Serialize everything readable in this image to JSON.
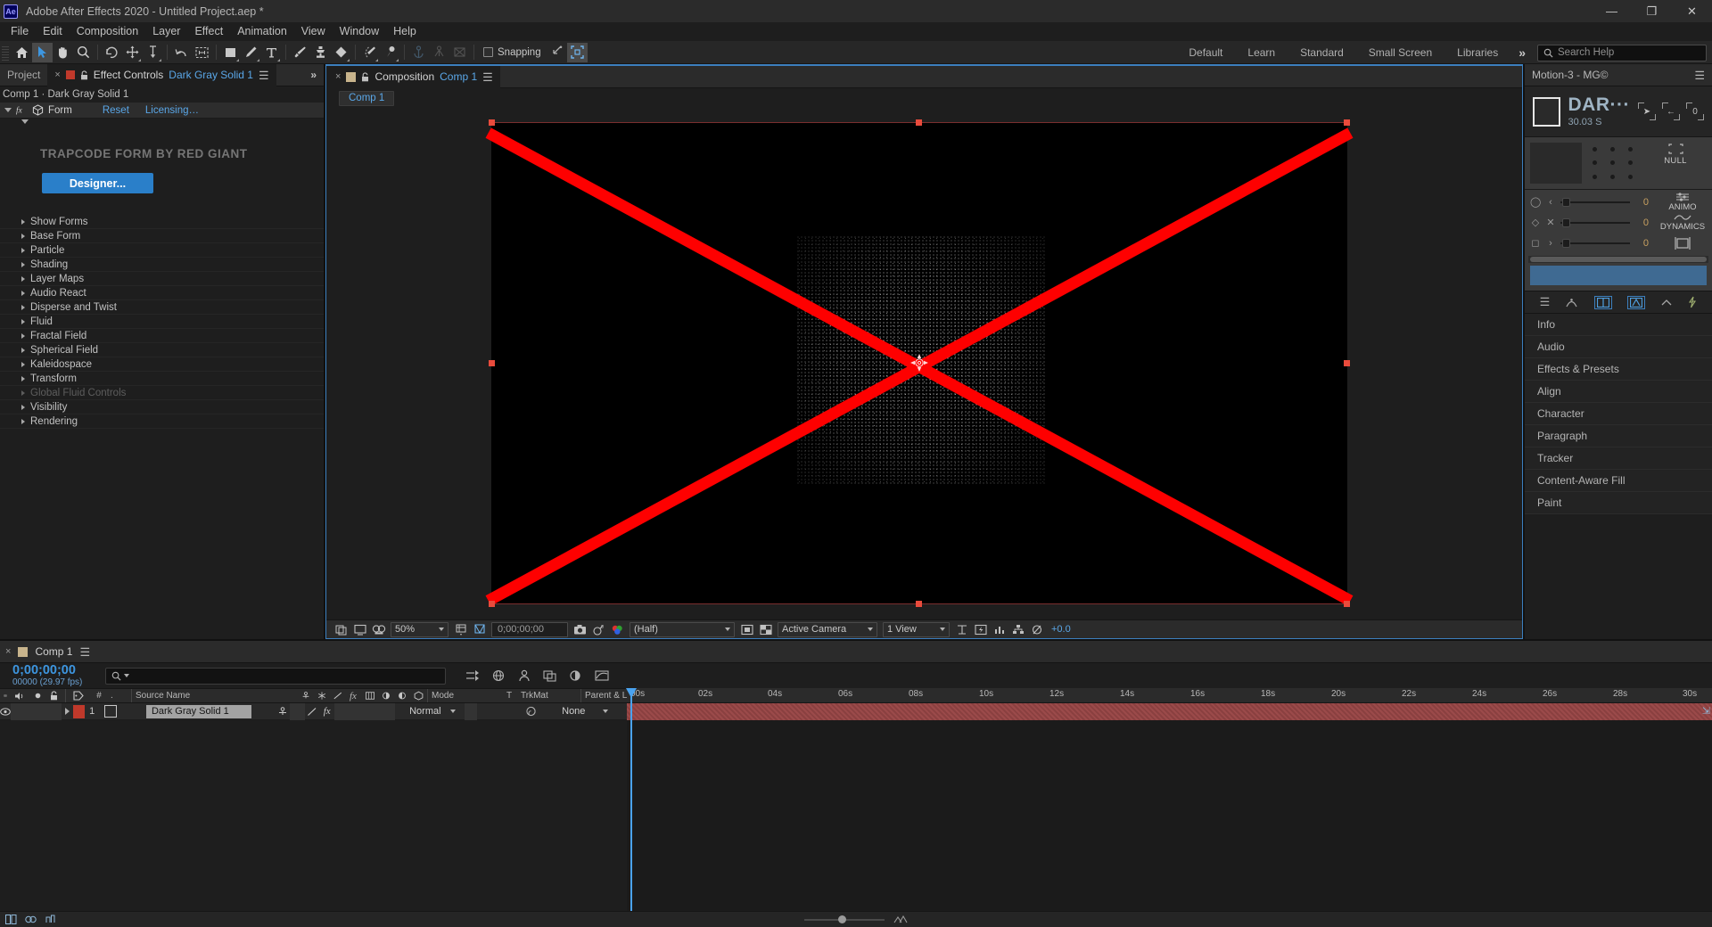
{
  "titlebar": {
    "logo": "Ae",
    "title": "Adobe After Effects 2020 - Untitled Project.aep *",
    "minimize": "—",
    "maximize": "❐",
    "close": "✕"
  },
  "menubar": {
    "items": [
      "File",
      "Edit",
      "Composition",
      "Layer",
      "Effect",
      "Animation",
      "View",
      "Window",
      "Help"
    ]
  },
  "toolbar": {
    "snapping_label": "Snapping",
    "workspaces": [
      "Default",
      "Learn",
      "Standard",
      "Small Screen",
      "Libraries"
    ],
    "more": "»",
    "search_placeholder": "Search Help",
    "tools": [
      "home-icon",
      "selection-tool",
      "hand-tool",
      "zoom-tool",
      "rotation-tool",
      "unified-camera-tool",
      "pan-behind-tool",
      "shape-tool",
      "pen-tool",
      "type-tool",
      "brush-tool",
      "clone-stamp-tool",
      "eraser-tool",
      "roto-brush-tool",
      "puppet-pin-tool"
    ]
  },
  "effect_controls": {
    "tab_project": "Project",
    "tab_close": "×",
    "tab_label": "Effect Controls",
    "tab_layer": "Dark Gray Solid 1",
    "breadcrumb": "Comp 1 · Dark Gray Solid 1",
    "effect_name": "Form",
    "reset": "Reset",
    "licensing": "Licensing…",
    "brand_text": "TRAPCODE FORM BY RED GIANT",
    "designer_button": "Designer...",
    "parameters": [
      {
        "label": "Show Forms",
        "disabled": false
      },
      {
        "label": "Base Form",
        "disabled": false
      },
      {
        "label": "Particle",
        "disabled": false
      },
      {
        "label": "Shading",
        "disabled": false
      },
      {
        "label": "Layer Maps",
        "disabled": false
      },
      {
        "label": "Audio React",
        "disabled": false
      },
      {
        "label": "Disperse and Twist",
        "disabled": false
      },
      {
        "label": "Fluid",
        "disabled": false
      },
      {
        "label": "Fractal Field",
        "disabled": false
      },
      {
        "label": "Spherical Field",
        "disabled": false
      },
      {
        "label": "Kaleidospace",
        "disabled": false
      },
      {
        "label": "Transform",
        "disabled": false
      },
      {
        "label": "Global Fluid Controls",
        "disabled": true
      },
      {
        "label": "Visibility",
        "disabled": false
      },
      {
        "label": "Rendering",
        "disabled": false
      }
    ]
  },
  "composition": {
    "tab_close": "×",
    "tab_label": "Composition",
    "tab_comp_name": "Comp 1",
    "subtab": "Comp 1",
    "toolbar": {
      "zoom_level": "50%",
      "timecode": "0;00;00;00",
      "resolution": "(Half)",
      "camera": "Active Camera",
      "views": "1 View",
      "exposure": "+0.0"
    }
  },
  "right_panel": {
    "title": "Motion-3 - MG©",
    "mg": {
      "name": "DAR···",
      "duration": "30.03 S",
      "buttons": [
        "NULL",
        "ANIMO",
        "DYNAMICS"
      ],
      "slider_values": [
        "0",
        "0",
        "0"
      ]
    },
    "panels": [
      "Info",
      "Audio",
      "Effects & Presets",
      "Align",
      "Character",
      "Paragraph",
      "Tracker",
      "Content-Aware Fill",
      "Paint"
    ]
  },
  "timeline": {
    "tab_close": "×",
    "comp_name": "Comp 1",
    "current_time": "0;00;00;00",
    "frame_info": "00000 (29.97 fps)",
    "search_placeholder": "",
    "columns": {
      "num": "#",
      "source_name": "Source Name",
      "mode": "Mode",
      "t": "T",
      "trkmat": "TrkMat",
      "parent": "Parent & Link"
    },
    "layers": [
      {
        "index": "1",
        "name": "Dark Gray Solid 1",
        "mode": "Normal",
        "parent": "None"
      }
    ],
    "ruler_ticks": [
      "00s",
      "02s",
      "04s",
      "06s",
      "08s",
      "10s",
      "12s",
      "14s",
      "16s",
      "18s",
      "20s",
      "22s",
      "24s",
      "26s",
      "28s",
      "30s"
    ]
  },
  "colors": {
    "accent_blue": "#3d96e0",
    "link_blue": "#5aa7e8",
    "button_blue": "#2a7fc9",
    "red_x": "#fe0000",
    "layer_red": "#c0392b"
  }
}
